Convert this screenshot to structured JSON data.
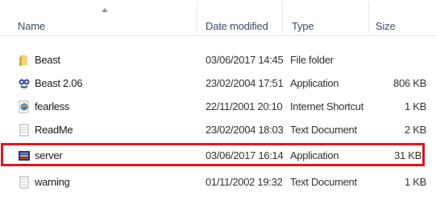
{
  "columns": {
    "name": "Name",
    "date": "Date modified",
    "type": "Type",
    "size": "Size"
  },
  "rows": [
    {
      "icon": "folder-icon",
      "name": "Beast",
      "date": "03/06/2017 14:45",
      "type": "File folder",
      "size": ""
    },
    {
      "icon": "application-icon",
      "name": "Beast 2.06",
      "date": "23/02/2004 17:51",
      "type": "Application",
      "size": "806 KB"
    },
    {
      "icon": "internet-shortcut-icon",
      "name": "fearless",
      "date": "22/11/2001 20:10",
      "type": "Internet Shortcut",
      "size": "1 KB"
    },
    {
      "icon": "text-document-icon",
      "name": "ReadMe",
      "date": "23/02/2004 18:03",
      "type": "Text Document",
      "size": "2 KB"
    },
    {
      "icon": "server-app-icon",
      "name": "server",
      "date": "03/06/2017 16:14",
      "type": "Application",
      "size": "31 KB",
      "highlighted": true
    },
    {
      "icon": "text-document-icon",
      "name": "warning",
      "date": "01/11/2002 19:32",
      "type": "Text Document",
      "size": "1 KB"
    }
  ],
  "colors": {
    "highlight_border": "#e2161e",
    "header_text": "#3b4d66"
  }
}
